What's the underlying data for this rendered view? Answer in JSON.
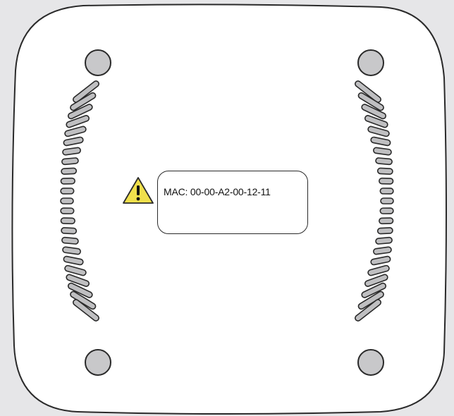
{
  "device": {
    "mac_label": "MAC: 00-00-A2-00-12-11",
    "warning_icon": "warning-triangle-icon"
  },
  "colors": {
    "background": "#e6e6e8",
    "device_body": "#ffffff",
    "outline": "#2a2a2a",
    "feet": "#c8c8ca",
    "vents": "#bfbfc1",
    "warning_fill": "#f0e04c"
  }
}
